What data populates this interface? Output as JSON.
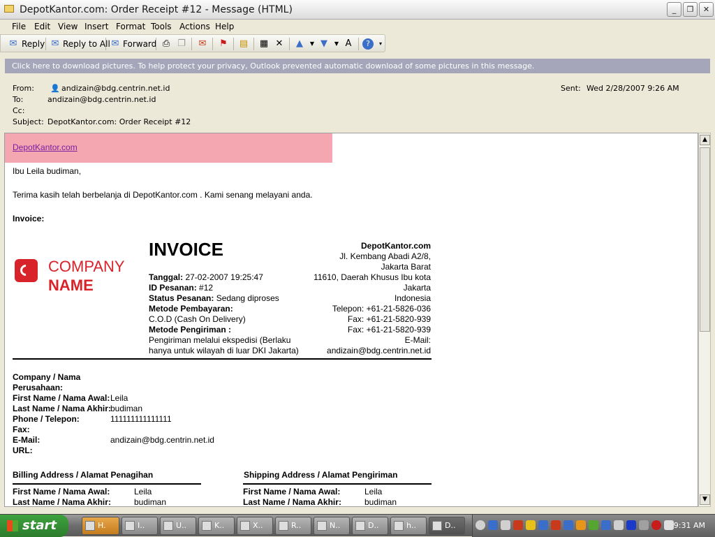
{
  "window": {
    "title": "DepotKantor.com: Order Receipt #12 - Message (HTML)"
  },
  "menu": [
    "File",
    "Edit",
    "View",
    "Insert",
    "Format",
    "Tools",
    "Actions",
    "Help"
  ],
  "toolbar": {
    "reply": "Reply",
    "reply_all": "Reply to All",
    "forward": "Forward"
  },
  "infobar": "Click here to download pictures. To help protect your privacy, Outlook prevented automatic download of some pictures in this message.",
  "header": {
    "from_label": "From:",
    "from": "andizain@bdg.centrin.net.id",
    "to_label": "To:",
    "to": "andizain@bdg.centrin.net.id",
    "cc_label": "Cc:",
    "subject_label": "Subject:",
    "subject": "DepotKantor.com: Order Receipt #12",
    "sent_label": "Sent:",
    "sent": "Wed 2/28/2007 9:26 AM"
  },
  "email": {
    "link": "DepotKantor.com",
    "greeting": "Ibu Leila budiman,",
    "thanks": "Terima kasih telah berbelanja di DepotKantor.com . Kami senang melayani anda.",
    "invoice_label": "Invoice:",
    "logo": {
      "company": "COMPANY",
      "name": "NAME"
    },
    "invoice_title": "INVOICE",
    "tanggal_label": "Tanggal:",
    "tanggal": " 27-02-2007 19:25:47",
    "id_label": "ID Pesanan:",
    "id": " #12",
    "status_label": "Status Pesanan:",
    "status": " Sedang diproses",
    "metode_bayar_label": "Metode Pembayaran:",
    "metode_bayar": "C.O.D (Cash On Delivery)",
    "metode_kirim_label": "Metode Pengiriman :",
    "metode_kirim_1": "Pengiriman melalui ekspedisi (Berlaku",
    "metode_kirim_2": "hanya untuk wilayah di luar DKI Jakarta)",
    "store": {
      "name": "DepotKantor.com",
      "addr1": "Jl. Kembang Abadi A2/8,",
      "addr2": "Jakarta Barat",
      "addr3": "11610, Daerah Khusus Ibu kota",
      "addr4": "Jakarta",
      "addr5": "Indonesia",
      "phone": "Telepon: +61-21-5826-036",
      "fax1": "Fax: +61-21-5820-939",
      "fax2": "Fax: +61-21-5820-939",
      "email_label": "E-Mail:",
      "email": "andizain@bdg.centrin.net.id"
    },
    "customer": {
      "company_label_1": "Company / Nama",
      "company_label_2": "Perusahaan:",
      "first_label": "First Name / Nama Awal:",
      "first": "Leila",
      "last_label": "Last Name / Nama Akhir:",
      "last": "budiman",
      "phone_label": "Phone / Telepon:",
      "phone": "111111111111111",
      "fax_label": "Fax:",
      "email_label": "E-Mail:",
      "email": "andizain@bdg.centrin.net.id",
      "url_label": "URL:"
    },
    "billing": {
      "title": "Billing Address / Alamat Penagihan",
      "first_label": "First Name / Nama Awal:",
      "first": "Leila",
      "last_label": "Last Name / Nama Akhir:",
      "last": "budiman"
    },
    "shipping": {
      "title": "Shipping Address / Alamat Pengiriman",
      "first_label": "First Name / Nama Awal:",
      "first": "Leila",
      "last_label": "Last Name / Nama Akhir:",
      "last": "budiman"
    }
  },
  "taskbar": {
    "start": "start",
    "tasks": [
      "H.",
      "I..",
      "U..",
      "K..",
      "X..",
      "R..",
      "N..",
      "D..",
      "h..",
      "D.."
    ],
    "clock": "9:31 AM"
  }
}
